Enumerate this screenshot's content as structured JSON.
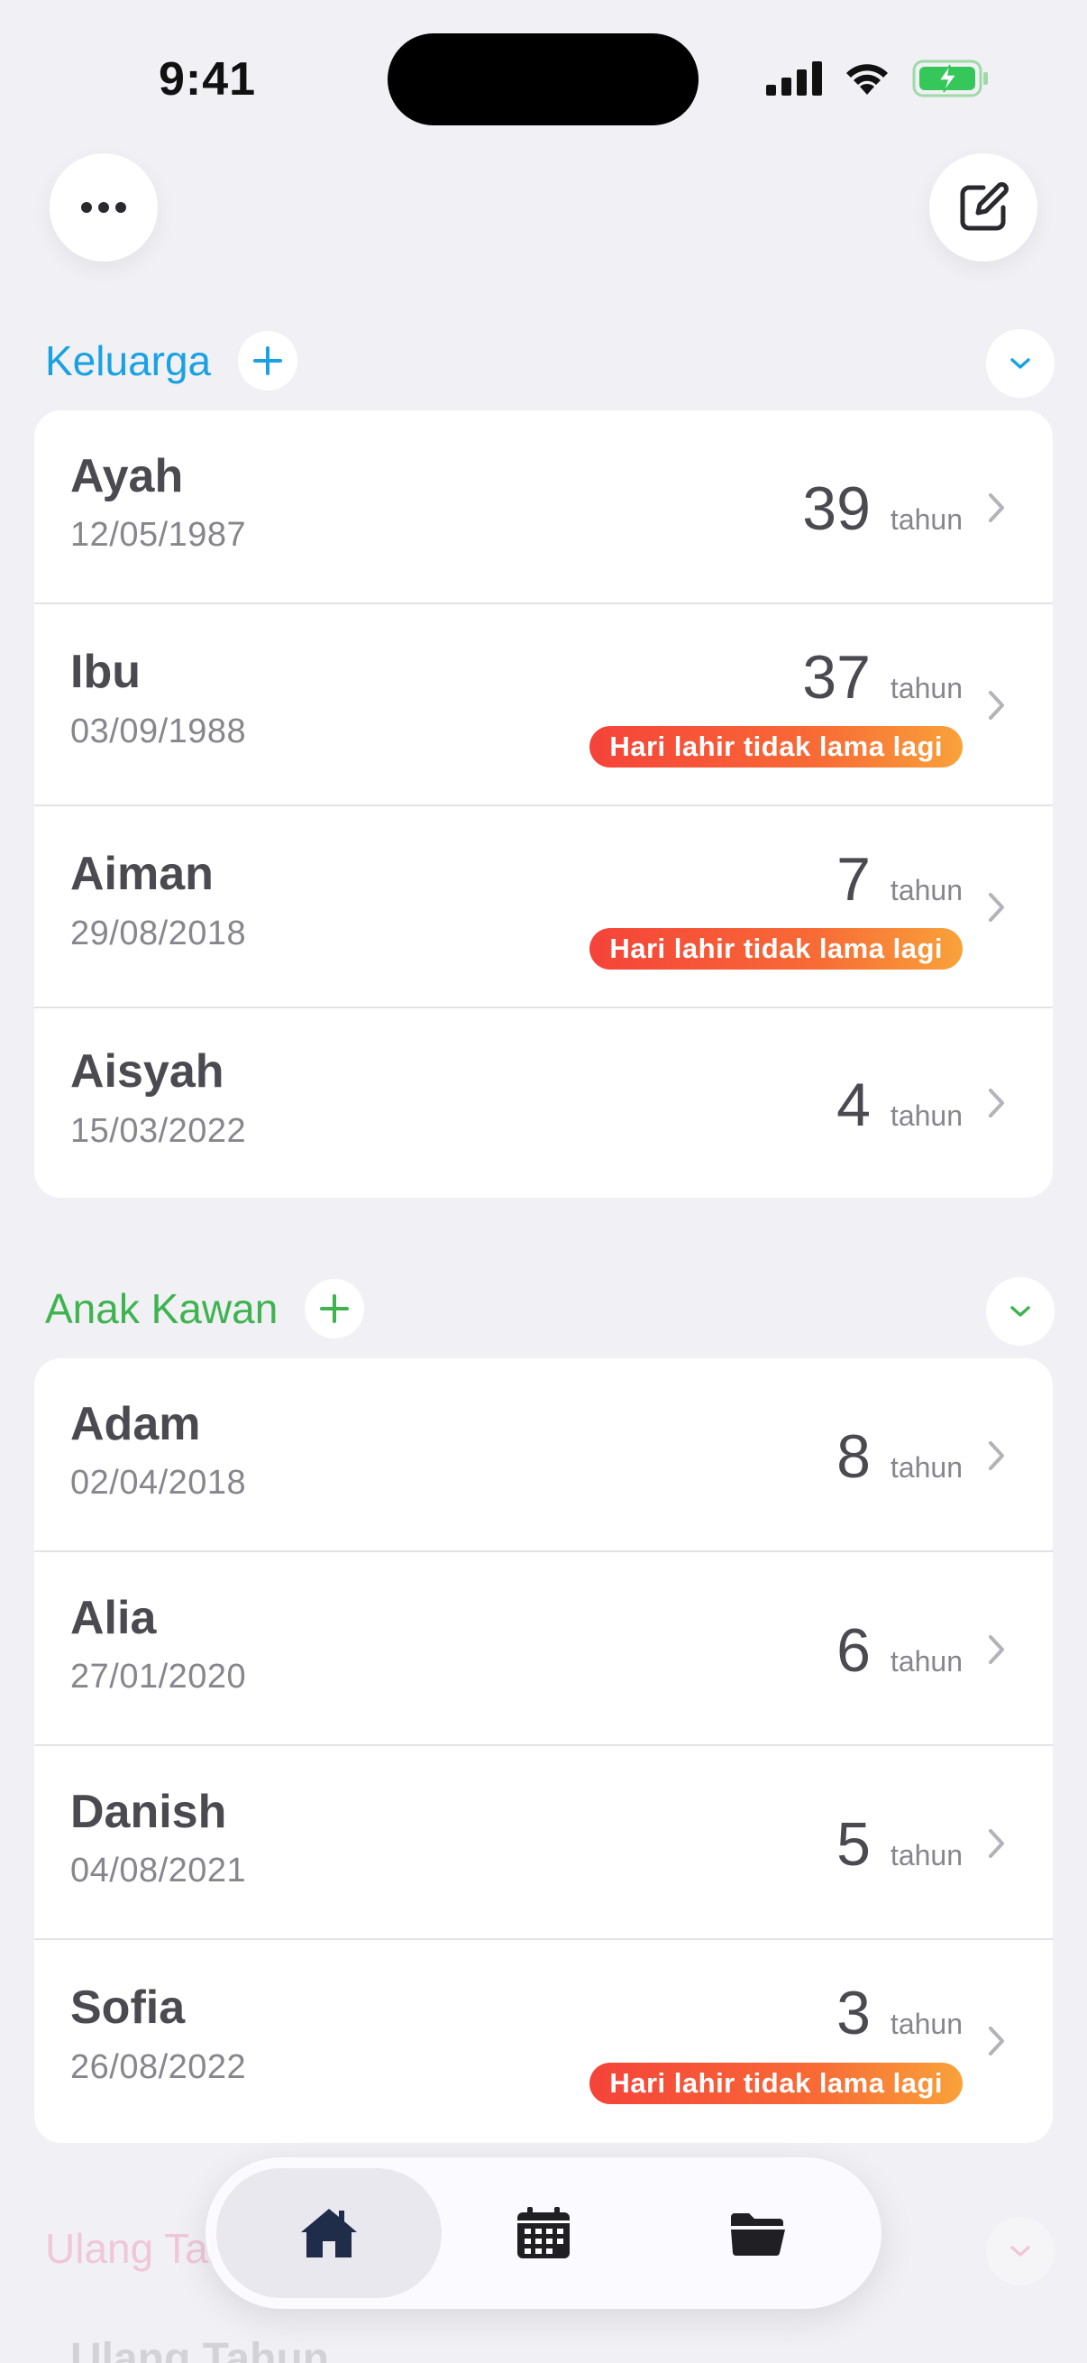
{
  "status_bar": {
    "time": "9:41"
  },
  "sections": [
    {
      "title": "Keluarga",
      "color": "#1aa1e2",
      "people": [
        {
          "name": "Ayah",
          "date": "12/05/1987",
          "age": "39",
          "unit": "tahun"
        },
        {
          "name": "Ibu",
          "date": "03/09/1988",
          "age": "37",
          "unit": "tahun",
          "badge": "Hari lahir tidak lama lagi"
        },
        {
          "name": "Aiman",
          "date": "29/08/2018",
          "age": "7",
          "unit": "tahun",
          "badge": "Hari lahir tidak lama lagi"
        },
        {
          "name": "Aisyah",
          "date": "15/03/2022",
          "age": "4",
          "unit": "tahun"
        }
      ]
    },
    {
      "title": "Anak Kawan",
      "color": "#3fb350",
      "people": [
        {
          "name": "Adam",
          "date": "02/04/2018",
          "age": "8",
          "unit": "tahun"
        },
        {
          "name": "Alia",
          "date": "27/01/2020",
          "age": "6",
          "unit": "tahun"
        },
        {
          "name": "Danish",
          "date": "04/08/2021",
          "age": "5",
          "unit": "tahun"
        },
        {
          "name": "Sofia",
          "date": "26/08/2022",
          "age": "3",
          "unit": "tahun",
          "badge": "Hari lahir tidak lama lagi"
        }
      ]
    },
    {
      "title": "Ulang Tahun",
      "color": "#f07aa0",
      "people": [
        {
          "name": "Ulang Tahun"
        }
      ]
    }
  ],
  "tab_bar": {
    "tabs": [
      {
        "icon": "house-icon",
        "active": true
      },
      {
        "icon": "calendar-icon",
        "active": false
      },
      {
        "icon": "folder-icon",
        "active": false
      }
    ]
  }
}
